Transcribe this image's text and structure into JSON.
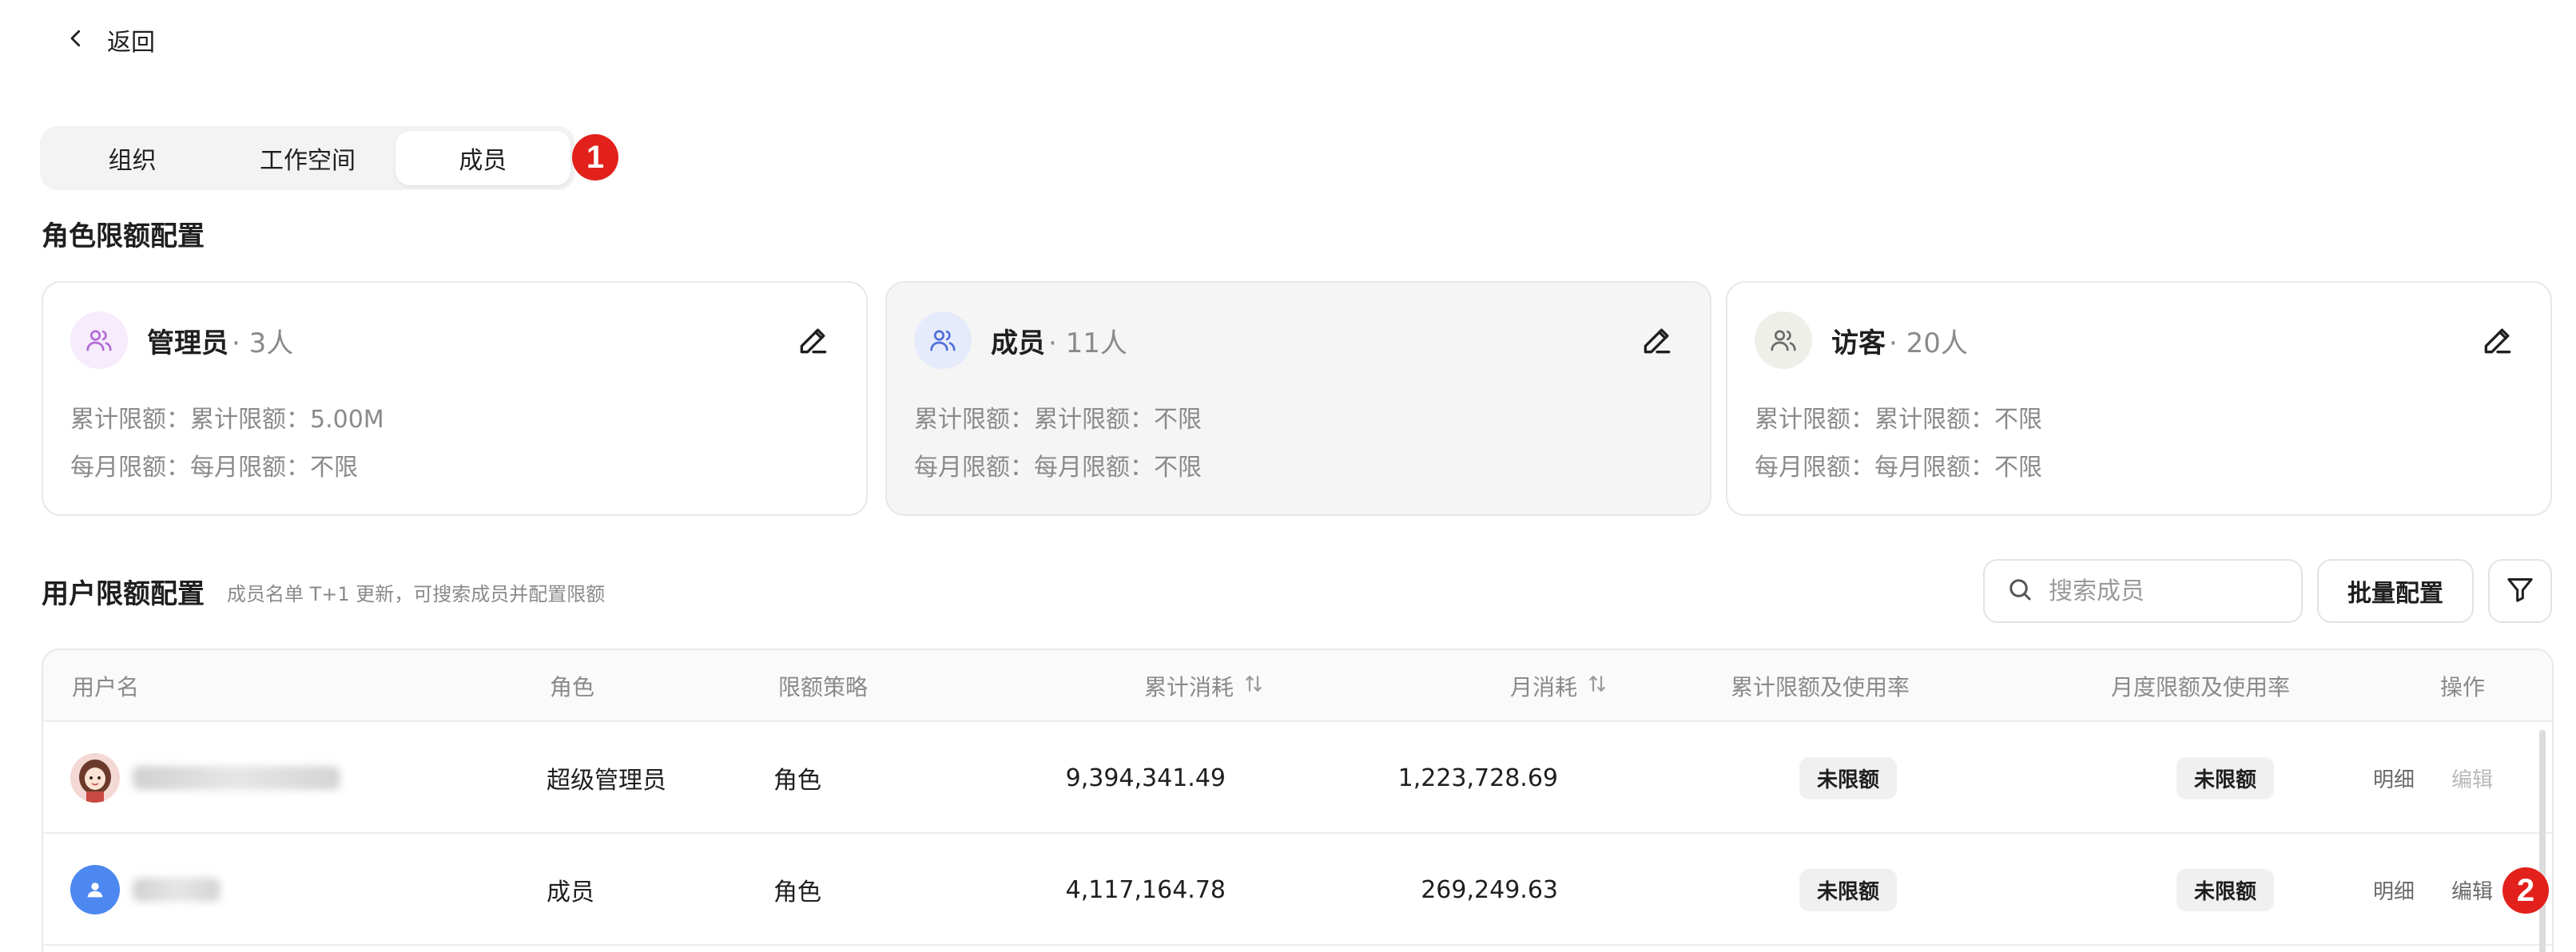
{
  "back": {
    "label": "返回",
    "icon": "chevron-left-icon"
  },
  "tabs": [
    {
      "label": "组织",
      "active": false
    },
    {
      "label": "工作空间",
      "active": false
    },
    {
      "label": "成员",
      "active": true
    }
  ],
  "badges": {
    "one": "1",
    "two": "2"
  },
  "role_section": {
    "title": "角色限额配置"
  },
  "roles": [
    {
      "name": "管理员",
      "count": "· 3人",
      "total_line": "累计限额：累计限额：5.00M",
      "monthly_line": "每月限额：每月限额：不限",
      "color": "#b36ad8",
      "bg": "#f6ecfb"
    },
    {
      "name": "成员",
      "count": "· 11人",
      "total_line": "累计限额：累计限额：不限",
      "monthly_line": "每月限额：每月限额：不限",
      "color": "#4f6fd8",
      "bg": "#e6ebfb"
    },
    {
      "name": "访客",
      "count": "· 20人",
      "total_line": "累计限额：累计限额：不限",
      "monthly_line": "每月限额：每月限额：不限",
      "color": "#6b6b6b",
      "bg": "#efefe9"
    }
  ],
  "user_section": {
    "title": "用户限额配置",
    "subtitle": "成员名单 T+1 更新，可搜索成员并配置限额"
  },
  "search": {
    "placeholder": "搜索成员",
    "value": ""
  },
  "batch_button": "批量配置",
  "table": {
    "headers": {
      "username": "用户名",
      "role": "角色",
      "policy": "限额策略",
      "total_usage": "累计消耗",
      "monthly_usage": "月消耗",
      "total_limit": "累计限额及使用率",
      "monthly_limit": "月度限额及使用率",
      "actions": "操作"
    },
    "rows": [
      {
        "role": "超级管理员",
        "policy": "角色",
        "total_usage": "9,394,341.49",
        "monthly_usage": "1,223,728.69",
        "total_limit": "未限额",
        "monthly_limit": "未限额",
        "detail": "明细",
        "edit": "编辑",
        "edit_enabled": false
      },
      {
        "role": "成员",
        "policy": "角色",
        "total_usage": "4,117,164.78",
        "monthly_usage": "269,249.63",
        "total_limit": "未限额",
        "monthly_limit": "未限额",
        "detail": "明细",
        "edit": "编辑",
        "edit_enabled": true
      }
    ]
  }
}
